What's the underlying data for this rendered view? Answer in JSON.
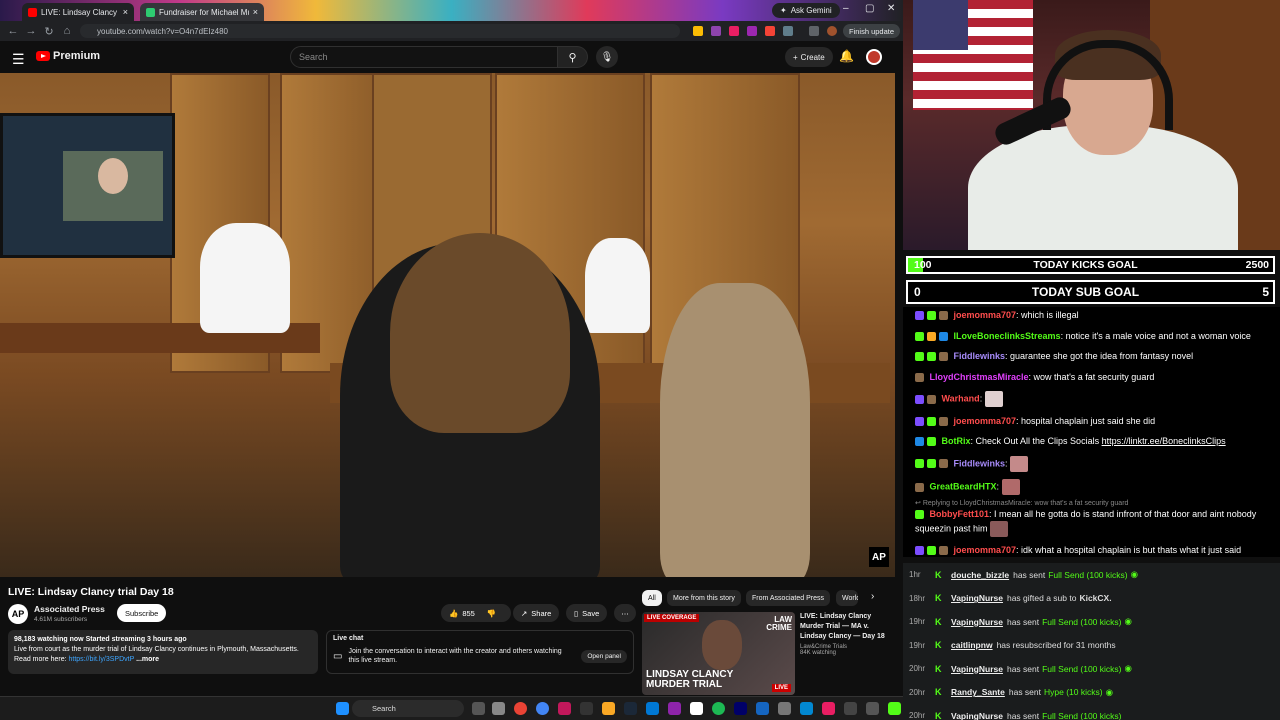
{
  "browser": {
    "tabs": [
      {
        "label": "LIVE: Lindsay Clancy trial D",
        "active": true
      },
      {
        "label": "Fundraiser for Michael Musgro",
        "active": false
      }
    ],
    "ask_gemini": "Ask Gemini",
    "url": "youtube.com/watch?v=O4n7dEIz480",
    "finish_update": "Finish update"
  },
  "youtube": {
    "logo": "Premium",
    "search_placeholder": "Search",
    "create_label": "Create"
  },
  "video": {
    "watermark": "AP",
    "title": "LIVE: Lindsay Clancy trial Day 18",
    "channel": {
      "name": "Associated Press",
      "subs": "4.61M subscribers",
      "avatar": "AP"
    },
    "subscribe_label": "Subscribe",
    "likes": "855",
    "share_label": "Share",
    "save_label": "Save",
    "description": {
      "stats": "98,183 watching now  Started streaming 3 hours ago",
      "line1": "Live from court as the murder trial of Lindsay Clancy continues in Plymouth, Massachusetts.",
      "read_more": "Read more here:",
      "link": "https://bit.ly/3SPDvtP",
      "more": "...more"
    },
    "live_chat": {
      "title": "Live chat",
      "text": "Join the conversation to interact with the creator and others watching this live stream.",
      "button": "Open panel"
    }
  },
  "recommendations": {
    "chips": [
      "All",
      "More from this story",
      "From Associated Press",
      "World"
    ],
    "item": {
      "badge": "LIVE COVERAGE",
      "thumb_text": "LINDSAY CLANCY MURDER TRIAL",
      "brand": "LAW CRIME",
      "live": "LIVE",
      "title": "LIVE: Lindsay Clancy Murder Trial — MA v. Lindsay Clancy — Day 18",
      "channel": "Law&Crime Trials",
      "watching": "84K watching"
    }
  },
  "taskbar": {
    "search_label": "Search"
  },
  "stream": {
    "kicks_goal": {
      "current": "100",
      "label": "TODAY KICKS GOAL",
      "target": "2500",
      "fraction": 0.04
    },
    "sub_goal": {
      "current": "0",
      "label": "TODAY SUB GOAL",
      "target": "5"
    },
    "chat": [
      {
        "user": "joemomma707",
        "color": "#ff4d4d",
        "text": ": which is illegal"
      },
      {
        "user": "ILoveBoneclinksStreams",
        "color": "#53fc18",
        "text": ": notice it's a male voice and not a woman voice"
      },
      {
        "user": "Fiddlewinks",
        "color": "#a78bfa",
        "text": ": guarantee she got the idea from fantasy novel"
      },
      {
        "user": "LloydChristmasMiracle",
        "color": "#e040fb",
        "text": ": wow that's a fat security guard"
      },
      {
        "user": "Warhand",
        "color": "#ff4d4d",
        "text": ":"
      },
      {
        "user": "joemomma707",
        "color": "#ff4d4d",
        "text": ": hospital chaplain just said she did"
      },
      {
        "user": "BotRix",
        "color": "#53fc18",
        "text": ": Check Out All the Clips Socials ",
        "link": "https://linktr.ee/BoneclinksClips"
      },
      {
        "user": "Fiddlewinks",
        "color": "#a78bfa",
        "text": ":"
      },
      {
        "user": "GreatBeardHTX",
        "color": "#53fc18",
        "text": ":"
      },
      {
        "reply": "Replying to LloydChristmasMiracle: wow that's a fat security guard",
        "user": "BobbyFett101",
        "color": "#ff4d4d",
        "text": ": I mean all he gotta do is stand infront of that door and aint nobody squeezin past him"
      },
      {
        "user": "joemomma707",
        "color": "#ff4d4d",
        "text": ": idk what a hospital chaplain is but thats what it just said"
      }
    ],
    "events": [
      {
        "time": "1hr",
        "user": "douche_bizzle",
        "pre": "has sent",
        "hl": "Full Send (100 kicks)",
        "post": ""
      },
      {
        "time": "18hr",
        "user": "VapingNurse",
        "pre": "has gifted a sub to",
        "hl": "",
        "post": "KickCX."
      },
      {
        "time": "19hr",
        "user": "VapingNurse",
        "pre": "has sent",
        "hl": "Full Send (100 kicks)",
        "post": ""
      },
      {
        "time": "19hr",
        "user": "caitlinpnw",
        "pre": "has resubscribed for 31 months",
        "hl": "",
        "post": ""
      },
      {
        "time": "20hr",
        "user": "VapingNurse",
        "pre": "has sent",
        "hl": "Full Send (100 kicks)",
        "post": ""
      },
      {
        "time": "20hr",
        "user": "Randy_Sante",
        "pre": "has sent",
        "hl": "Hype (10 kicks)",
        "post": ""
      },
      {
        "time": "20hr",
        "user": "VapingNurse",
        "pre": "has sent",
        "hl": "Full Send (100 kicks)",
        "post": ""
      }
    ]
  }
}
